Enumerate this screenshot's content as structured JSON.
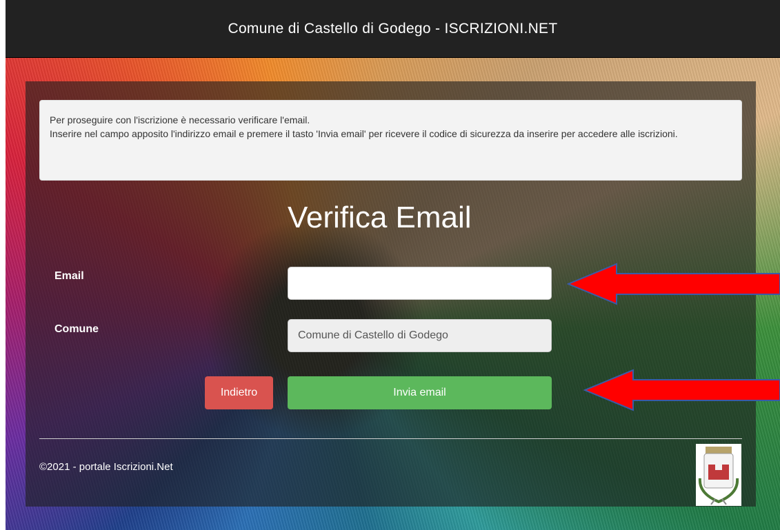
{
  "header": {
    "title": "Comune di Castello di Godego - ISCRIZIONI.NET"
  },
  "notice": {
    "line1": "Per proseguire con l'iscrizione è necessario verificare l'email.",
    "line2": "Inserire nel campo apposito l'indirizzo email e premere il tasto 'Invia email' per ricevere il codice di sicurezza da inserire per accedere alle iscrizioni."
  },
  "form": {
    "heading": "Verifica Email",
    "email_label": "Email",
    "email_value": "",
    "comune_label": "Comune",
    "comune_value": "Comune di Castello di Godego"
  },
  "buttons": {
    "back_label": "Indietro",
    "send_label": "Invia email"
  },
  "footer": {
    "copyright": "©2021 - portale Iscrizioni.Net"
  },
  "colors": {
    "topbar": "#222222",
    "danger": "#d9534f",
    "success": "#5cb85c",
    "annotation_arrow": "#ff0000"
  }
}
